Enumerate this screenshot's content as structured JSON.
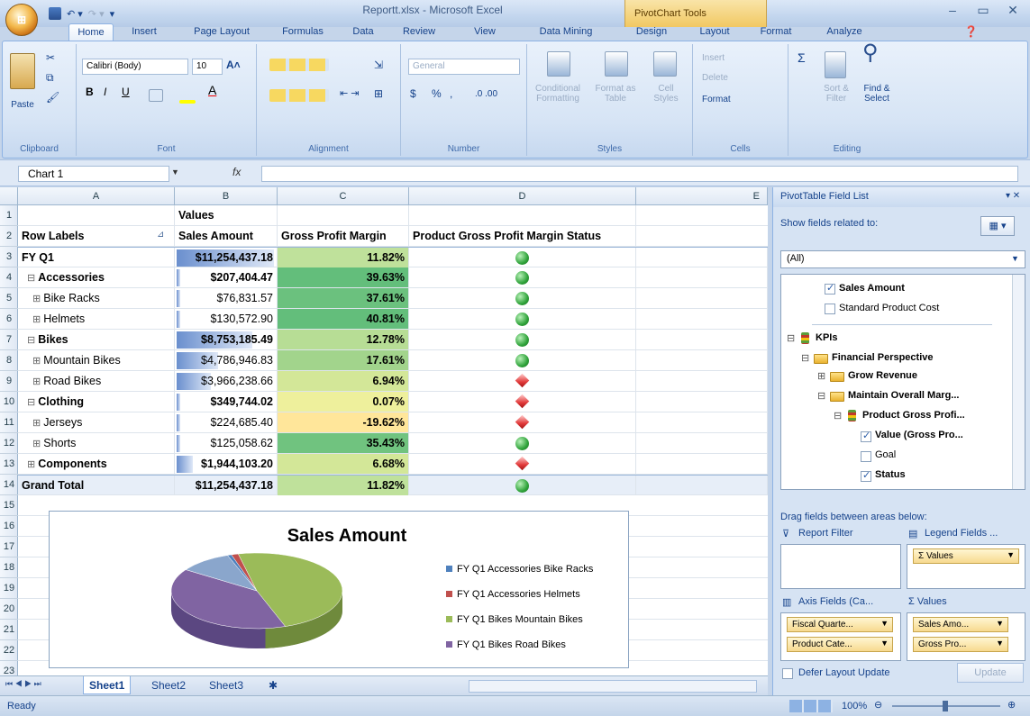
{
  "window": {
    "title": "Reportt.xlsx - Microsoft Excel",
    "contextual_tab": "PivotChart Tools"
  },
  "ribbon_tabs": [
    "Home",
    "Insert",
    "Page Layout",
    "Formulas",
    "Data",
    "Review",
    "View",
    "Data Mining",
    "Design",
    "Layout",
    "Format",
    "Analyze"
  ],
  "ribbon": {
    "clipboard": {
      "paste": "Paste",
      "label": "Clipboard"
    },
    "font": {
      "name": "Calibri (Body)",
      "size": "10",
      "label": "Font",
      "bold": "B",
      "italic": "I",
      "underline": "U"
    },
    "alignment": {
      "label": "Alignment"
    },
    "number": {
      "format": "General",
      "currency": "$",
      "percent": "%",
      "comma": ",",
      "label": "Number"
    },
    "styles": {
      "conditional": "Conditional Formatting",
      "format_table": "Format as Table",
      "cell_styles": "Cell Styles",
      "label": "Styles"
    },
    "cells": {
      "insert": "Insert",
      "delete": "Delete",
      "format": "Format",
      "label": "Cells"
    },
    "editing": {
      "sigma": "Σ",
      "sort": "Sort & Filter",
      "find": "Find & Select",
      "label": "Editing"
    }
  },
  "formula_bar": {
    "name_box": "Chart 1",
    "fx": "fx",
    "value": ""
  },
  "columns": [
    "A",
    "B",
    "C",
    "D",
    "E"
  ],
  "header_rows": {
    "r1": {
      "num": "1",
      "b": "Values"
    },
    "r2": {
      "num": "2",
      "a": "Row Labels",
      "b": "Sales Amount",
      "c": "Gross Profit Margin",
      "d": "Product Gross Profit Margin Status"
    }
  },
  "rows": [
    {
      "num": "3",
      "label": "FY Q1",
      "indent": 0,
      "toggle": "",
      "bold": true,
      "sales": "$11,254,437.18",
      "bar": 1.0,
      "margin": "11.82%",
      "mcolor": "#bfe19b",
      "status": "good"
    },
    {
      "num": "4",
      "label": "Accessories",
      "indent": 1,
      "toggle": "⊟",
      "bold": true,
      "sales": "$207,404.47",
      "bar": 0.02,
      "margin": "39.63%",
      "mcolor": "#63be7b",
      "status": "good"
    },
    {
      "num": "5",
      "label": "Bike Racks",
      "indent": 2,
      "toggle": "⊞",
      "bold": false,
      "sales": "$76,831.57",
      "bar": 0.01,
      "margin": "37.61%",
      "mcolor": "#6bc17e",
      "status": "good"
    },
    {
      "num": "6",
      "label": "Helmets",
      "indent": 2,
      "toggle": "⊞",
      "bold": false,
      "sales": "$130,572.90",
      "bar": 0.015,
      "margin": "40.81%",
      "mcolor": "#63be7b",
      "status": "good"
    },
    {
      "num": "7",
      "label": "Bikes",
      "indent": 1,
      "toggle": "⊟",
      "bold": true,
      "sales": "$8,753,185.49",
      "bar": 0.78,
      "margin": "12.78%",
      "mcolor": "#b7dd95",
      "status": "good"
    },
    {
      "num": "8",
      "label": "Mountain Bikes",
      "indent": 2,
      "toggle": "⊞",
      "bold": false,
      "sales": "$4,786,946.83",
      "bar": 0.43,
      "margin": "17.61%",
      "mcolor": "#a2d48c",
      "status": "good"
    },
    {
      "num": "9",
      "label": "Road Bikes",
      "indent": 2,
      "toggle": "⊞",
      "bold": false,
      "sales": "$3,966,238.66",
      "bar": 0.35,
      "margin": "6.94%",
      "mcolor": "#d3e798",
      "status": "bad"
    },
    {
      "num": "10",
      "label": "Clothing",
      "indent": 1,
      "toggle": "⊟",
      "bold": true,
      "sales": "$349,744.02",
      "bar": 0.03,
      "margin": "0.07%",
      "mcolor": "#eef09c",
      "status": "bad"
    },
    {
      "num": "11",
      "label": "Jerseys",
      "indent": 2,
      "toggle": "⊞",
      "bold": false,
      "sales": "$224,685.40",
      "bar": 0.02,
      "margin": "-19.62%",
      "mcolor": "#ffe69a",
      "status": "bad"
    },
    {
      "num": "12",
      "label": "Shorts",
      "indent": 2,
      "toggle": "⊞",
      "bold": false,
      "sales": "$125,058.62",
      "bar": 0.011,
      "margin": "35.43%",
      "mcolor": "#70c37f",
      "status": "good"
    },
    {
      "num": "13",
      "label": "Components",
      "indent": 1,
      "toggle": "⊞",
      "bold": true,
      "sales": "$1,944,103.20",
      "bar": 0.17,
      "margin": "6.68%",
      "mcolor": "#d3e798",
      "status": "bad"
    },
    {
      "num": "14",
      "label": "Grand Total",
      "indent": 0,
      "toggle": "",
      "bold": true,
      "sales": "$11,254,437.18",
      "bar": 0,
      "margin": "11.82%",
      "mcolor": "#bfe19b",
      "status": "good"
    }
  ],
  "empty_rows": [
    "15",
    "16",
    "17",
    "18",
    "19",
    "20",
    "21",
    "22",
    "23"
  ],
  "chart": {
    "title": "Sales Amount",
    "legend": [
      {
        "label": "FY Q1 Accessories Bike Racks",
        "color": "#4f81bd"
      },
      {
        "label": "FY Q1 Accessories Helmets",
        "color": "#c0504d"
      },
      {
        "label": "FY Q1 Bikes Mountain Bikes",
        "color": "#9bbb59"
      },
      {
        "label": "FY Q1 Bikes Road Bikes",
        "color": "#8064a2"
      }
    ]
  },
  "chart_data": {
    "type": "pie",
    "title": "Sales Amount",
    "categories": [
      "FY Q1 Accessories Bike Racks",
      "FY Q1 Accessories Helmets",
      "FY Q1 Bikes Mountain Bikes",
      "FY Q1 Bikes Road Bikes"
    ],
    "values": [
      76831.57,
      130572.9,
      4786946.83,
      3966238.66
    ],
    "extra_slice_estimated": {
      "label_visible": false,
      "approx_share": 0.1
    }
  },
  "sheet_tabs": [
    "Sheet1",
    "Sheet2",
    "Sheet3"
  ],
  "status": {
    "left": "Ready",
    "zoom": "100%"
  },
  "pivot_pane": {
    "title": "PivotTable Field List",
    "related_label": "Show fields related to:",
    "related_value": "(All)",
    "fields": [
      {
        "label": "Sales Amount",
        "checked": true,
        "bold": true
      },
      {
        "label": "Standard Product Cost",
        "checked": false,
        "bold": false
      }
    ],
    "kpis": "KPIs",
    "tree": [
      "Financial Perspective",
      "Grow Revenue",
      "Maintain Overall Marg...",
      "Product Gross Profi..."
    ],
    "kpi_items": [
      {
        "label": "Value (Gross Pro...",
        "checked": true
      },
      {
        "label": "Goal",
        "checked": false
      },
      {
        "label": "Status",
        "checked": true
      }
    ],
    "drag_label": "Drag fields between areas below:",
    "report_filter": "Report Filter",
    "legend_fields": "Legend Fields ...",
    "legend_chip": "Σ Values",
    "axis_fields": "Axis Fields (Ca...",
    "values_area": "Σ  Values",
    "axis_chips": [
      "Fiscal Quarte...",
      "Product Cate..."
    ],
    "value_chips": [
      "Sales Amo...",
      "Gross Pro..."
    ],
    "defer": "Defer Layout Update",
    "update": "Update"
  }
}
